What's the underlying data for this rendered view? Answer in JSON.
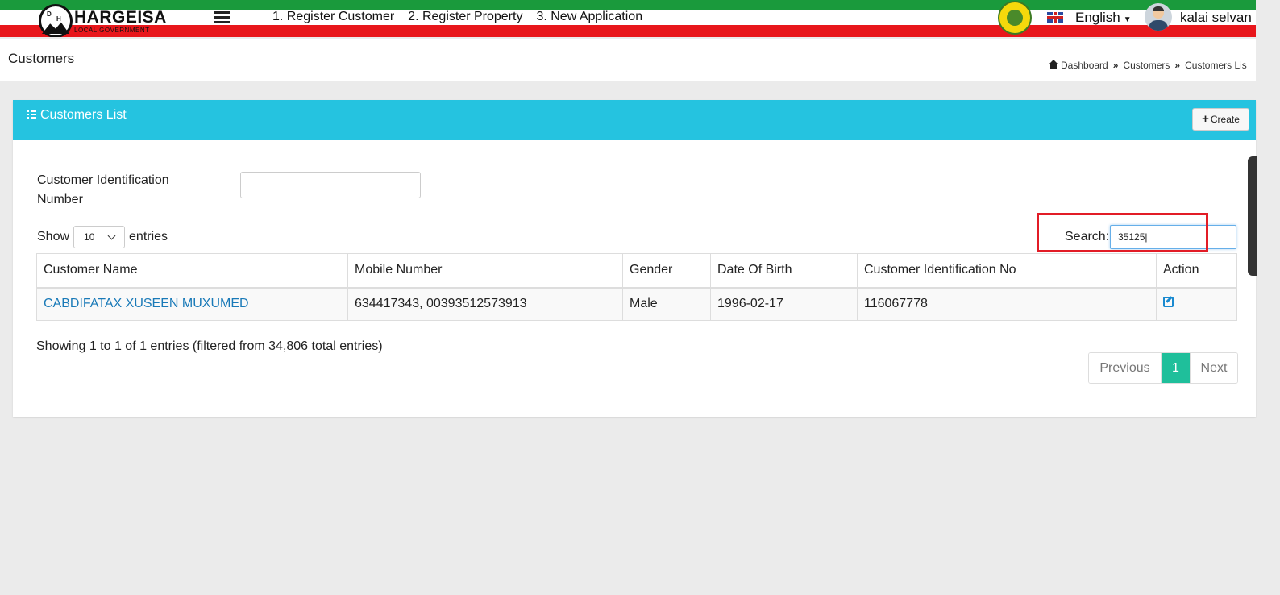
{
  "header": {
    "logo_title": "HARGEISA",
    "logo_subtitle": "LOCAL GOVERNMENT",
    "logo_letters": [
      "D",
      "H"
    ],
    "nav": [
      "1. Register Customer",
      "2. Register Property",
      "3. New Application"
    ],
    "language": "English",
    "user": "kalai selvan"
  },
  "page": {
    "title": "Customers",
    "breadcrumb": [
      "Dashboard",
      "Customers",
      "Customers Lis"
    ],
    "breadcrumb_sep": "»"
  },
  "card": {
    "title": "Customers List",
    "create_label": "Create"
  },
  "filters": {
    "cin_label": "Customer Identification Number",
    "cin_value": "",
    "show_label": "Show",
    "entries_value": "10",
    "entries_label": "entries",
    "search_label": "Search:",
    "search_value": "35125"
  },
  "table": {
    "columns": [
      "Customer Name",
      "Mobile Number",
      "Gender",
      "Date Of Birth",
      "Customer Identification No",
      "Action"
    ],
    "rows": [
      {
        "name": "CABDIFATAX XUSEEN MUXUMED",
        "mobile": "634417343, 00393512573913",
        "gender": "Male",
        "dob": "1996-02-17",
        "cin": "116067778"
      }
    ]
  },
  "footer": {
    "info": "Showing 1 to 1 of 1 entries (filtered from 34,806 total entries)",
    "prev": "Previous",
    "current": "1",
    "next": "Next"
  },
  "colors": {
    "accent": "#25c3e0",
    "pagination_active": "#1fbf9b",
    "link": "#1a7ab8",
    "highlight": "#e21c26"
  }
}
